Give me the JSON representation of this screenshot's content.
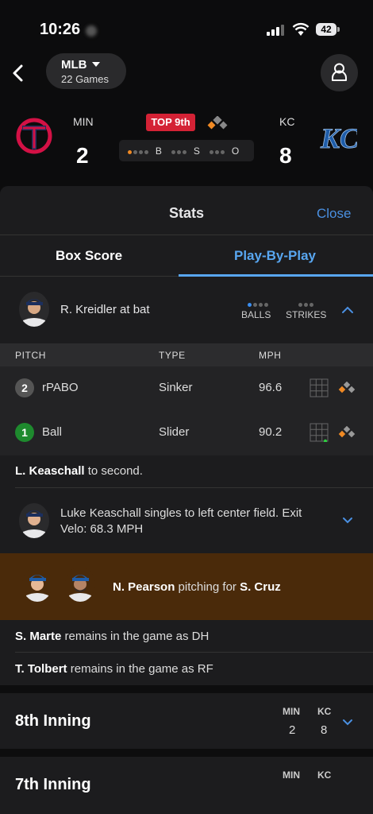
{
  "status_bar": {
    "time": "10:26",
    "battery": "42"
  },
  "nav": {
    "league": "MLB",
    "games": "22 Games"
  },
  "scoreboard": {
    "away": {
      "abbr": "MIN",
      "score": "2"
    },
    "home": {
      "abbr": "KC",
      "score": "8"
    },
    "inning": "TOP 9th",
    "count": {
      "balls_label": "B",
      "strikes_label": "S",
      "outs_label": "O",
      "balls": 1,
      "strikes": 0,
      "outs": 0
    }
  },
  "sheet": {
    "title": "Stats",
    "close": "Close"
  },
  "tabs": {
    "box_score": "Box Score",
    "play_by_play": "Play-By-Play"
  },
  "at_bat": {
    "text": "R. Kreidler at bat",
    "balls_label": "BALLS",
    "strikes_label": "STRIKES",
    "balls": 1,
    "strikes": 0
  },
  "pitch_table": {
    "headers": {
      "pitch": "PITCH",
      "type": "TYPE",
      "mph": "MPH"
    },
    "rows": [
      {
        "num": "2",
        "result": "rPABO",
        "type": "Sinker",
        "mph": "96.6"
      },
      {
        "num": "1",
        "result": "Ball",
        "type": "Slider",
        "mph": "90.2"
      }
    ]
  },
  "plays": {
    "advance": {
      "name": "L. Keaschall",
      "rest": " to second."
    },
    "single": "Luke Keaschall singles to left center field. Exit Velo: 68.3 MPH",
    "pitching": {
      "pitcher": "N. Pearson",
      "middle": " pitching for ",
      "replaced": "S. Cruz"
    },
    "marte": {
      "name": "S. Marte",
      "rest": " remains in the game as DH"
    },
    "tolbert": {
      "name": "T. Tolbert",
      "rest": " remains in the game as RF"
    }
  },
  "innings": [
    {
      "title": "8th Inning",
      "away_abbr": "MIN",
      "home_abbr": "KC",
      "away_runs": "2",
      "home_runs": "8"
    },
    {
      "title": "7th Inning",
      "away_abbr": "MIN",
      "home_abbr": "KC"
    }
  ],
  "colors": {
    "accent": "#58a6f0",
    "inning_badge": "#d42235",
    "pitching_band": "#4a2a0a",
    "ball_green": "#1e8a2e"
  }
}
